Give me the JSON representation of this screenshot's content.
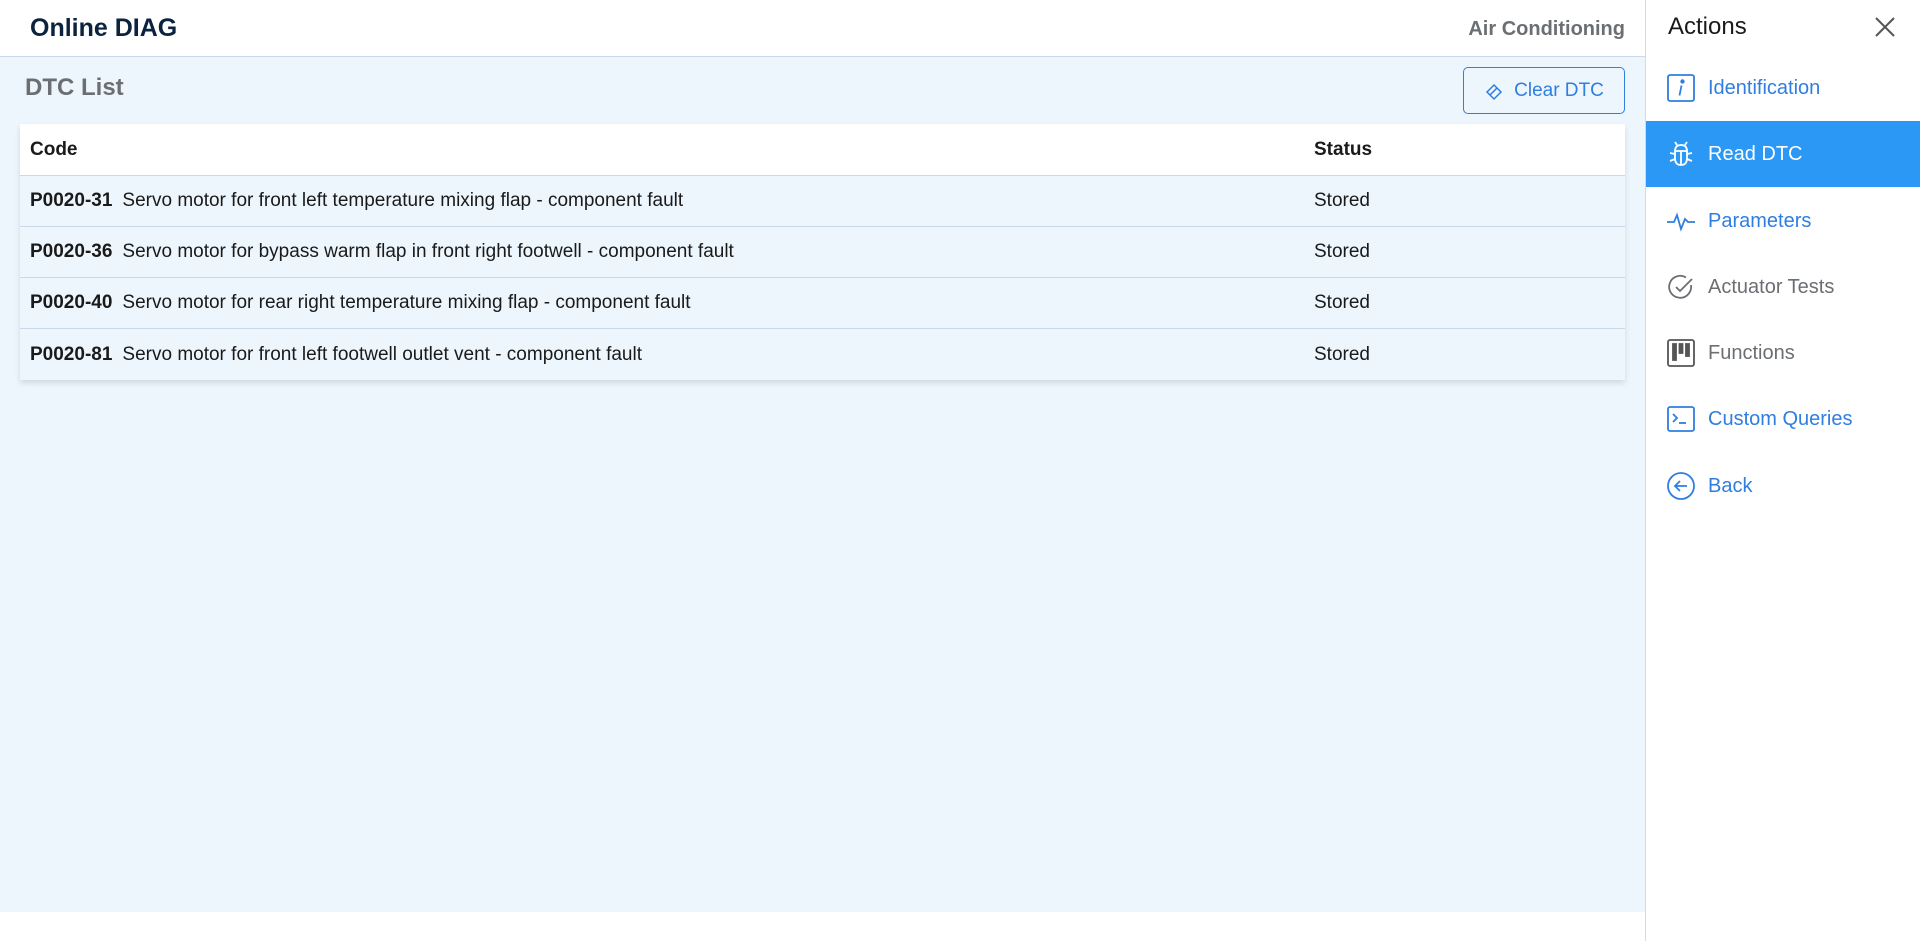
{
  "header": {
    "app_title": "Online DIAG",
    "module": "Air Conditioning"
  },
  "dtc": {
    "title": "DTC List",
    "clear_label": "Clear DTC",
    "columns": {
      "code": "Code",
      "status": "Status"
    },
    "rows": [
      {
        "code": "P0020-31",
        "description": "Servo motor for front left temperature mixing flap - component fault",
        "status": "Stored"
      },
      {
        "code": "P0020-36",
        "description": "Servo motor for bypass warm flap in front right footwell - component fault",
        "status": "Stored"
      },
      {
        "code": "P0020-40",
        "description": "Servo motor for rear right temperature mixing flap - component fault",
        "status": "Stored"
      },
      {
        "code": "P0020-81",
        "description": "Servo motor for front left footwell outlet vent - component fault",
        "status": "Stored"
      }
    ]
  },
  "actions": {
    "title": "Actions",
    "items": [
      {
        "label": "Identification",
        "icon": "info-icon"
      },
      {
        "label": "Read DTC",
        "icon": "bug-icon",
        "active": true
      },
      {
        "label": "Parameters",
        "icon": "pulse-icon"
      },
      {
        "label": "Actuator Tests",
        "icon": "check-circle-icon"
      },
      {
        "label": "Functions",
        "icon": "kanban-icon"
      },
      {
        "label": "Custom Queries",
        "icon": "terminal-icon"
      },
      {
        "label": "Back",
        "icon": "arrow-left-circle-icon"
      }
    ]
  },
  "colors": {
    "accent": "#2f7ee0",
    "active_bg": "#2b98f5",
    "content_bg": "#edf6fd",
    "title": "#0c2340"
  }
}
